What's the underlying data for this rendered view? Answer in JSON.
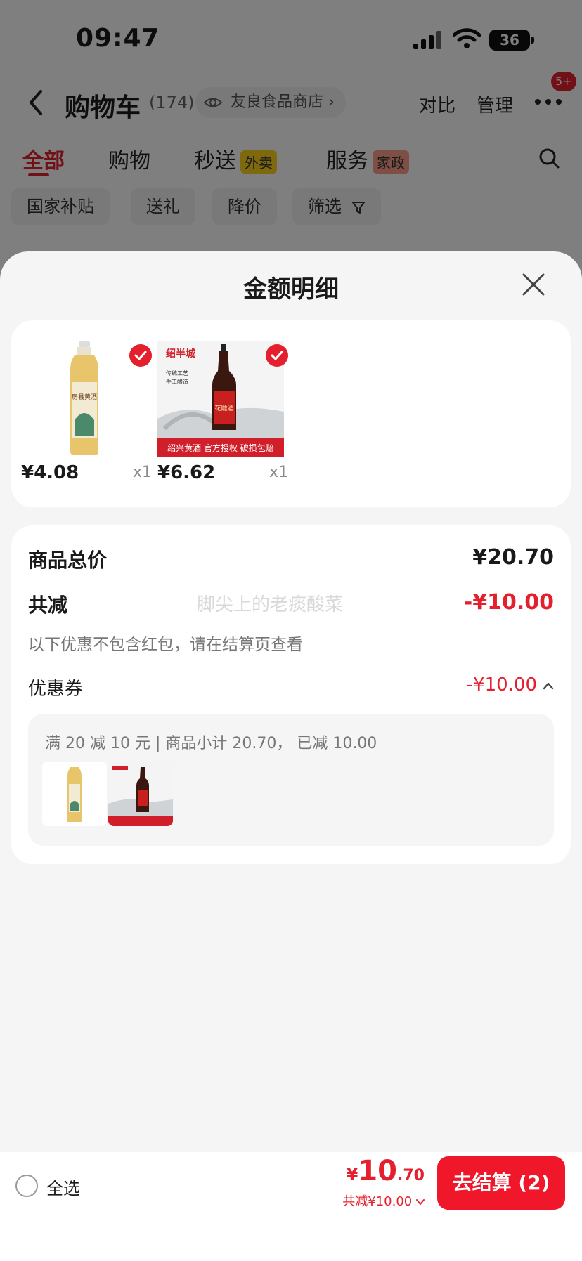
{
  "status": {
    "time": "09:47",
    "battery": "36"
  },
  "nav": {
    "title": "购物车",
    "count": "(174)",
    "shop": "友良食品商店",
    "compare": "对比",
    "manage": "管理",
    "badge": "5+"
  },
  "tabs": [
    {
      "label": "全部"
    },
    {
      "label": "购物"
    },
    {
      "label": "秒送",
      "tag": "外卖"
    },
    {
      "label": "服务",
      "tag": "家政"
    }
  ],
  "chips": [
    "国家补贴",
    "送礼",
    "降价",
    "筛选"
  ],
  "sheet": {
    "title": "金额明细",
    "products": [
      {
        "price": "¥4.08",
        "qty": "x1",
        "label": "房县黄酒"
      },
      {
        "price": "¥6.62",
        "qty": "x1",
        "brand": "绍半城",
        "text1": "传统工艺",
        "text2": "手工酿造",
        "bottle": "花雕酒",
        "banner": "绍兴黄酒 官方授权 破损包赔"
      }
    ],
    "total_label": "商品总价",
    "total_value": "¥20.70",
    "reduce_label": "共减",
    "reduce_value": "-¥10.00",
    "note": "以下优惠不包含红包，请在结算页查看",
    "coupon_label": "优惠券",
    "coupon_value": "-¥10.00",
    "coupon_desc": "满 20 减 10 元 | 商品小计 20.70， 已减 10.00",
    "watermark": "脚尖上的老痰酸菜"
  },
  "bottom": {
    "select_all": "全选",
    "currency": "¥",
    "price_int": "10",
    "price_dec": ".70",
    "discount": "共减¥10.00",
    "checkout": "去结算 (2)"
  },
  "colors": {
    "accent": "#e5202e",
    "button": "#f0172a"
  }
}
